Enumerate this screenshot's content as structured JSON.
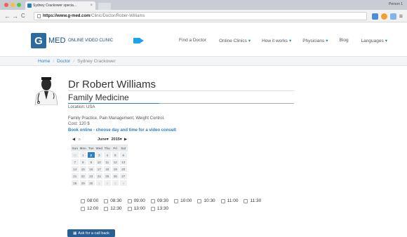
{
  "browser": {
    "tab_title": "Sydney Crackower specia...",
    "tab_close": "×",
    "profile": "Person 1",
    "url_domain": "https://www.g-med.com",
    "url_path": "/Clinic/Doctor/Rober-Williams",
    "back": "←",
    "forward": "→",
    "reload": "C",
    "menu": "≡"
  },
  "site": {
    "logo_letter": "G",
    "logo_name": "MED",
    "logo_tagline": "ONLINE VIDEO CLINIC",
    "nav": [
      {
        "label": "Find a Doctor",
        "caret": ""
      },
      {
        "label": "Online Clinics",
        "caret": "▾"
      },
      {
        "label": "How it works",
        "caret": "▾"
      },
      {
        "label": "Physicians",
        "caret": "▾"
      },
      {
        "label": "Blog",
        "caret": ""
      },
      {
        "label": "Languages",
        "caret": "▾"
      }
    ]
  },
  "breadcrumb": {
    "home": "Home",
    "doctor": "Doctor",
    "current": "Sydney Crackower",
    "separator": "/"
  },
  "doctor": {
    "name": "Dr Robert Williams",
    "specialty": "Family Medicine",
    "location": "Location: USA",
    "services": "Family Practice, Pain Management, Weight Control.",
    "cost": "Cost: 120 $",
    "book_title": "Book online - choose day and time for a video consult"
  },
  "calendar": {
    "prev": "◀",
    "home": "⌂",
    "month": "June",
    "year": "2015",
    "next": "▶",
    "dow": [
      "Sun",
      "Mon",
      "Tue",
      "Wed",
      "Thu",
      "Fri",
      "Sat"
    ],
    "weeks": [
      [
        "31",
        "1",
        "2",
        "3",
        "4",
        "5",
        "6"
      ],
      [
        "7",
        "8",
        "9",
        "10",
        "11",
        "12",
        "13"
      ],
      [
        "14",
        "15",
        "16",
        "17",
        "18",
        "19",
        "20"
      ],
      [
        "21",
        "22",
        "23",
        "24",
        "25",
        "26",
        "27"
      ],
      [
        "28",
        "29",
        "30",
        "1",
        "2",
        "3",
        "4"
      ]
    ],
    "selected": "2"
  },
  "time_slots": [
    "08:00",
    "08:30",
    "09:00",
    "09:30",
    "10:00",
    "10:30",
    "11:00",
    "11:30",
    "12:00",
    "12:30",
    "13:00",
    "13:30"
  ],
  "callback_button": "Ask for a call back",
  "colors": {
    "brand": "#2c6aa0",
    "accent": "#2c7fc4",
    "selected_day": "#2a80c6",
    "callback": "#2a5f93"
  }
}
